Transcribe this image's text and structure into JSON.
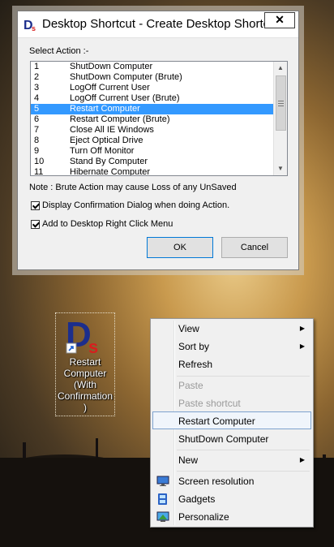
{
  "dialog": {
    "title": "Desktop Shortcut - Create Desktop Shortc...",
    "close_label": "✕",
    "select_label": "Select Action :-",
    "actions": [
      {
        "num": "1",
        "label": "ShutDown Computer"
      },
      {
        "num": "2",
        "label": "ShutDown Computer (Brute)"
      },
      {
        "num": "3",
        "label": "LogOff Current User"
      },
      {
        "num": "4",
        "label": "LogOff Current User (Brute)"
      },
      {
        "num": "5",
        "label": "Restart Computer",
        "selected": true
      },
      {
        "num": "6",
        "label": "Restart Computer (Brute)"
      },
      {
        "num": "7",
        "label": "Close All IE Windows"
      },
      {
        "num": "8",
        "label": "Eject Optical Drive"
      },
      {
        "num": "9",
        "label": "Turn Off Monitor"
      },
      {
        "num": "10",
        "label": "Stand By Computer"
      },
      {
        "num": "11",
        "label": "Hibernate Computer"
      }
    ],
    "note": "Note : Brute Action may cause Loss of any UnSaved",
    "confirm_label": "Display Confirmation Dialog when doing Action.",
    "confirm_checked": true,
    "rightclick_label": "Add to Desktop Right Click Menu",
    "rightclick_checked": true,
    "ok_label": "OK",
    "cancel_label": "Cancel"
  },
  "desktop_icon": {
    "caption": "Restart Computer (With Confirmation )"
  },
  "context_menu": {
    "view": "View",
    "sort_by": "Sort by",
    "refresh": "Refresh",
    "paste": "Paste",
    "paste_shortcut": "Paste shortcut",
    "restart_computer": "Restart Computer",
    "shutdown_computer": "ShutDown Computer",
    "new": "New",
    "screen_resolution": "Screen resolution",
    "gadgets": "Gadgets",
    "personalize": "Personalize",
    "submenu_arrow": "▶"
  },
  "colors": {
    "selection": "#3399ff",
    "menu_highlight_border": "#7da2ce",
    "icon_blue": "#1c2e8c",
    "icon_red": "#d81e1e"
  }
}
